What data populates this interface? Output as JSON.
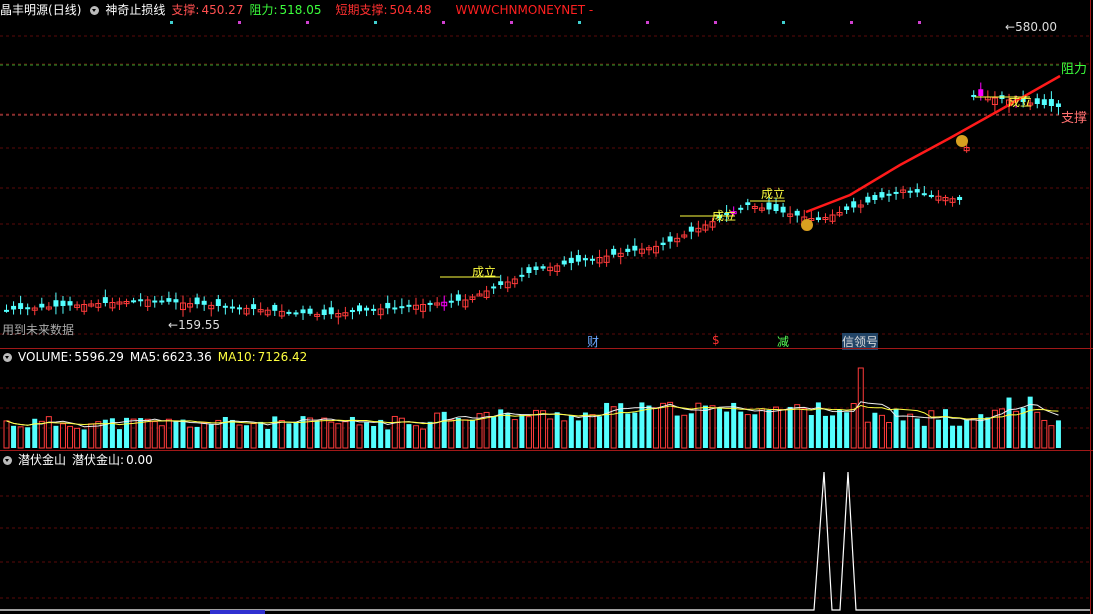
{
  "header": {
    "stock_name": "晶丰明源",
    "period": "(日线)",
    "indicator": "神奇止损线",
    "support_label": "支撑:",
    "support_value": "450.27",
    "resistance_label": "阻力:",
    "resistance_value": "518.05",
    "short_support_label": "短期支撑:",
    "short_support_value": "504.48",
    "watermark": "WWWCHNMONEYNET -"
  },
  "main": {
    "high_mark": "580.00",
    "low_mark": "159.55",
    "resistance_tag": "阻力",
    "support_tag": "支撑",
    "future_data_note": "用到未来数据",
    "signal_label": "成立",
    "bottom_tags": [
      "财",
      "$",
      "减",
      "信领号"
    ],
    "colors": {
      "up": "#ff3b3b",
      "down": "#54ffff",
      "hot": "#ff00ff",
      "support_line": "#ff1a1a"
    }
  },
  "volume": {
    "title": "VOLUME:",
    "value": "5596.29",
    "ma5_label": "MA5:",
    "ma5_value": "6623.36",
    "ma10_label": "MA10:",
    "ma10_value": "7126.42"
  },
  "indicator2": {
    "name": "潜伏金山",
    "label": "潜伏金山:",
    "value": "0.00"
  }
}
